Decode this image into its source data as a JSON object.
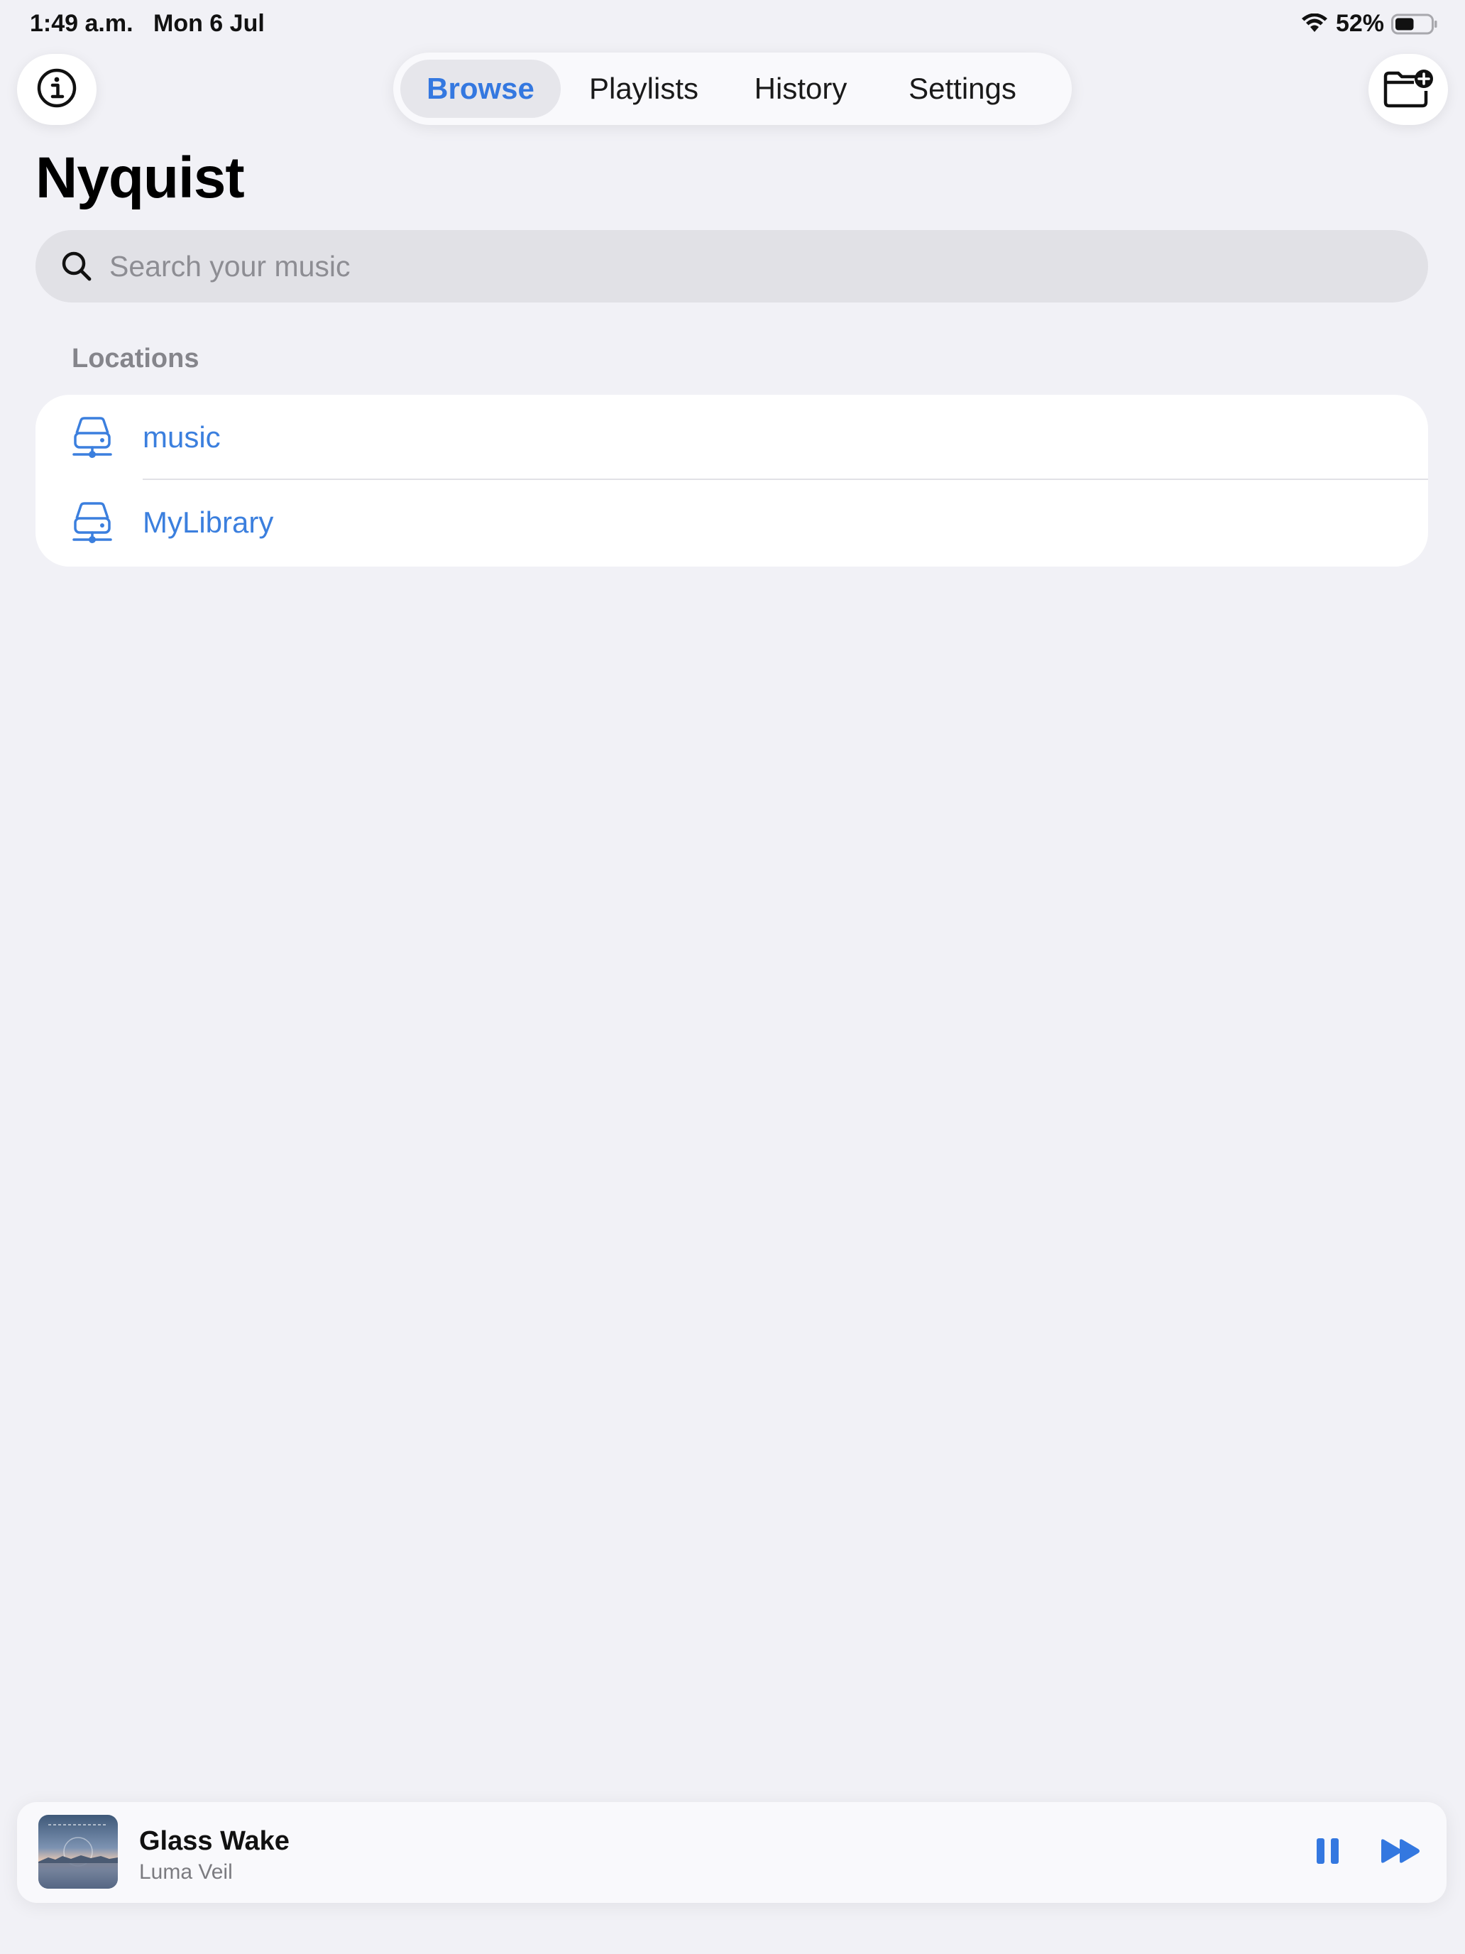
{
  "status_bar": {
    "time": "1:49 a.m.",
    "date": "Mon 6 Jul",
    "battery_percent": "52%",
    "battery_level": 0.52
  },
  "toolbar": {
    "info_icon": "info-circle-icon",
    "add_folder_icon": "folder-plus-icon"
  },
  "tabs": [
    {
      "label": "Browse",
      "active": true
    },
    {
      "label": "Playlists",
      "active": false
    },
    {
      "label": "History",
      "active": false
    },
    {
      "label": "Settings",
      "active": false
    }
  ],
  "page": {
    "title": "Nyquist"
  },
  "search": {
    "placeholder": "Search your music",
    "value": ""
  },
  "locations": {
    "header": "Locations",
    "items": [
      {
        "label": "music",
        "icon": "network-drive-icon"
      },
      {
        "label": "MyLibrary",
        "icon": "network-drive-icon"
      }
    ]
  },
  "now_playing": {
    "title": "Glass Wake",
    "artist": "Luma Veil",
    "state": "playing"
  },
  "colors": {
    "accent": "#3478e0",
    "background": "#f1f1f6",
    "card": "#ffffff",
    "secondary_text": "#85858b"
  }
}
